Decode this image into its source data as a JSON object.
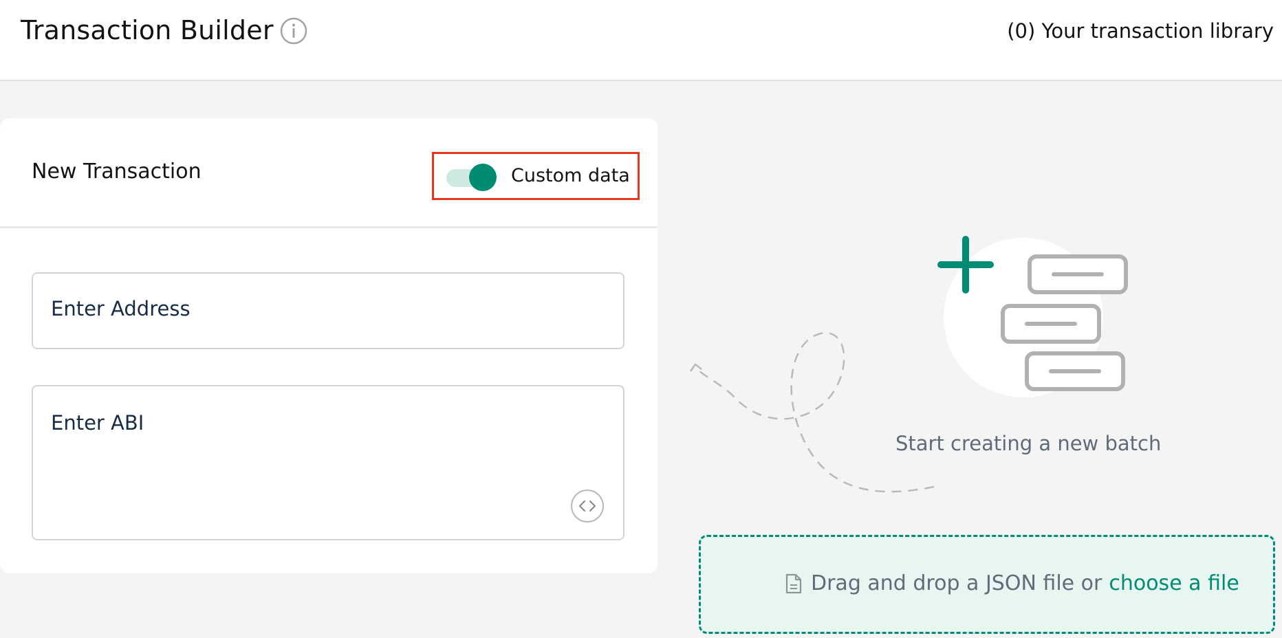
{
  "header": {
    "title": "Transaction Builder",
    "library_link": "(0) Your transaction library"
  },
  "new_transaction": {
    "title": "New Transaction",
    "custom_data_toggle": {
      "label": "Custom data",
      "checked": true
    },
    "address_placeholder": "Enter Address",
    "abi_placeholder": "Enter ABI"
  },
  "empty_state": {
    "message": "Start creating a new batch"
  },
  "dropzone": {
    "text": "Drag and drop a JSON file or",
    "link": "choose a file"
  },
  "colors": {
    "accent": "#008c73",
    "highlight_border": "#e8381c",
    "background": "#f4f4f4"
  }
}
